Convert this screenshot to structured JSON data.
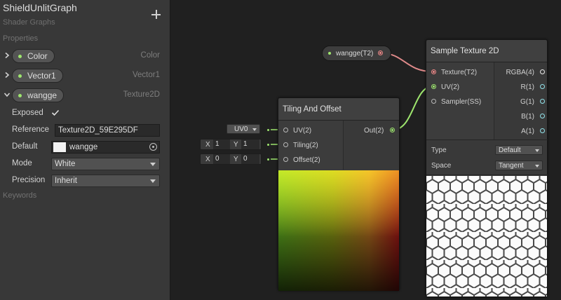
{
  "blackboard": {
    "title": "ShieldUnlitGraph",
    "subtitle": "Shader Graphs",
    "add_icon": "plus-icon",
    "properties_header": "Properties",
    "keywords_header": "Keywords",
    "properties": [
      {
        "name": "Color",
        "type": "Color",
        "expanded": false
      },
      {
        "name": "Vector1",
        "type": "Vector1",
        "expanded": false
      },
      {
        "name": "wangge",
        "type": "Texture2D",
        "expanded": true
      }
    ],
    "detail": {
      "exposed_label": "Exposed",
      "exposed_checked": true,
      "reference_label": "Reference",
      "reference_value": "Texture2D_59E295DF",
      "default_label": "Default",
      "default_value": "wangge",
      "mode_label": "Mode",
      "mode_value": "White",
      "precision_label": "Precision",
      "precision_value": "Inherit"
    }
  },
  "graph": {
    "property_node": {
      "label": "wangge(T2)"
    },
    "tiling_node": {
      "title": "Tiling And Offset",
      "inputs": [
        "UV(2)",
        "Tiling(2)",
        "Offset(2)"
      ],
      "output": "Out(2)",
      "uv_channel": "UV0",
      "tiling": {
        "x_label": "X",
        "x": "1",
        "y_label": "Y",
        "y": "1"
      },
      "offset": {
        "x_label": "X",
        "x": "0",
        "y_label": "Y",
        "y": "0"
      }
    },
    "sample_node": {
      "title": "Sample Texture 2D",
      "inputs": [
        "Texture(T2)",
        "UV(2)",
        "Sampler(SS)"
      ],
      "outputs": [
        "RGBA(4)",
        "R(1)",
        "G(1)",
        "B(1)",
        "A(1)"
      ],
      "type_label": "Type",
      "type_value": "Default",
      "space_label": "Space",
      "space_value": "Tangent"
    },
    "colors": {
      "background": "#202020",
      "node": "#393939",
      "vector_port": "#9ee66e",
      "texture_port": "#f08888",
      "float_port": "#92e4ec"
    }
  }
}
